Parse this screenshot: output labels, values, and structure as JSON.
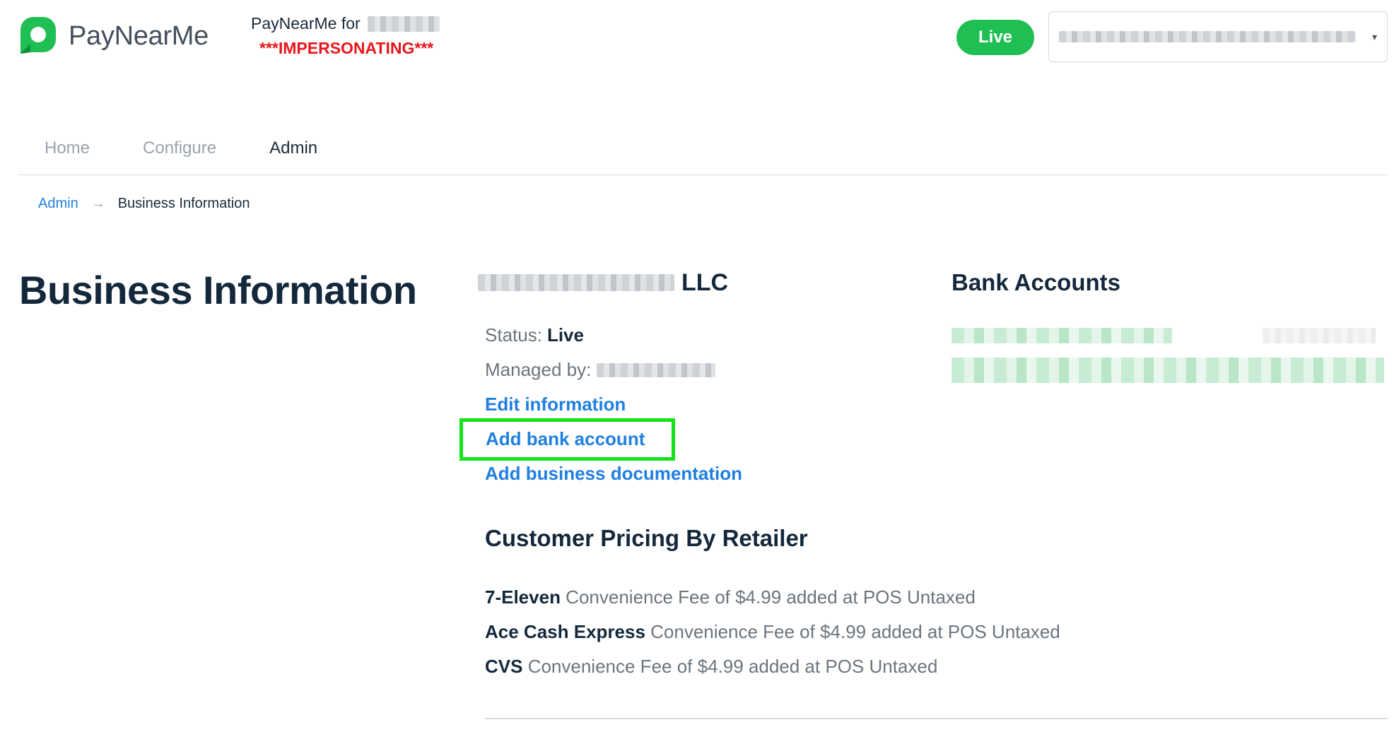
{
  "header": {
    "logo_text": "PayNearMe",
    "impersonation_label": "PayNearMe for",
    "impersonation_warning": "***IMPERSONATING***",
    "environment_badge": "Live",
    "account_selector_value": ""
  },
  "nav": {
    "tabs": [
      {
        "label": "Home",
        "active": false
      },
      {
        "label": "Configure",
        "active": false
      },
      {
        "label": "Admin",
        "active": true
      }
    ]
  },
  "breadcrumb": {
    "parent": "Admin",
    "separator": "→",
    "current": "Business Information"
  },
  "page": {
    "title": "Business Information"
  },
  "business": {
    "name_suffix": "LLC",
    "status_label": "Status:",
    "status_value": "Live",
    "managed_by_label": "Managed by:",
    "actions": {
      "edit": "Edit information",
      "add_bank": "Add bank account",
      "add_docs": "Add business documentation"
    }
  },
  "bank_accounts": {
    "title": "Bank Accounts"
  },
  "pricing": {
    "title": "Customer Pricing By Retailer",
    "rows": [
      {
        "retailer": "7-Eleven",
        "detail": "Convenience Fee of $4.99 added at POS Untaxed"
      },
      {
        "retailer": "Ace Cash Express",
        "detail": "Convenience Fee of $4.99 added at POS Untaxed"
      },
      {
        "retailer": "CVS",
        "detail": "Convenience Fee of $4.99 added at POS Untaxed"
      }
    ]
  },
  "colors": {
    "brand_green": "#1fbf53",
    "link_blue": "#1f7fe0",
    "warning_red": "#e8171b",
    "highlight_green": "#14e31a",
    "heading_navy": "#14283c"
  }
}
